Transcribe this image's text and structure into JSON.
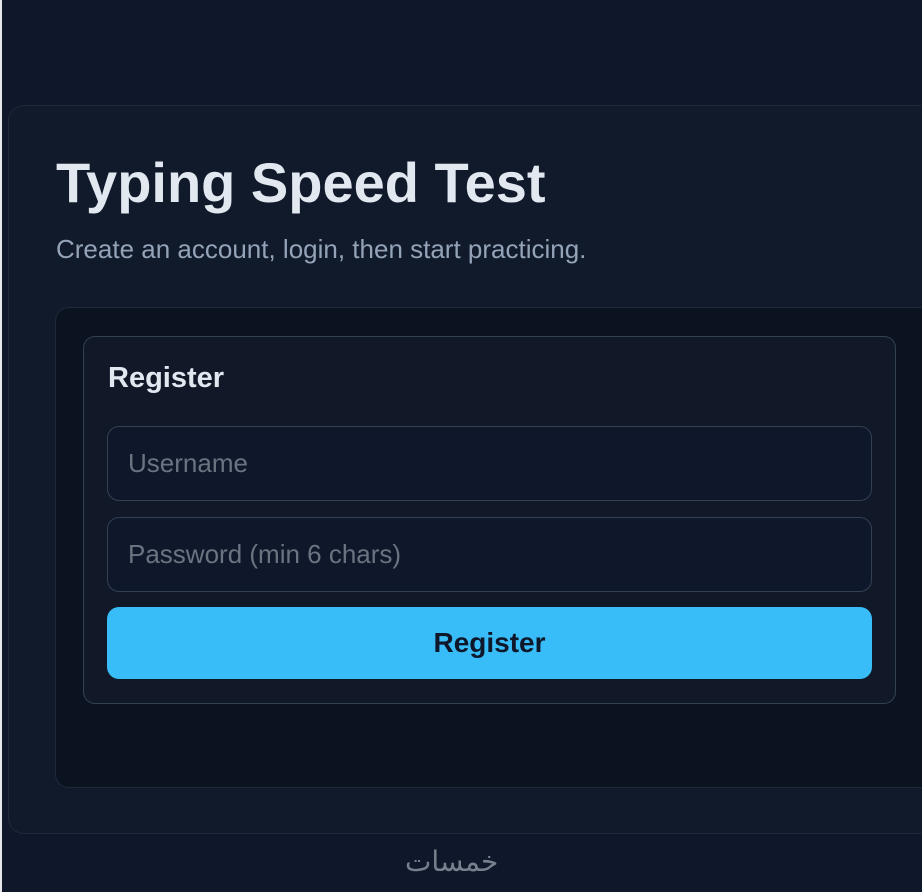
{
  "header": {
    "title": "Typing Speed Test",
    "subtitle": "Create an account, login, then start practicing."
  },
  "register": {
    "heading": "Register",
    "username_placeholder": "Username",
    "password_placeholder": "Password (min 6 chars)",
    "submit_label": "Register"
  },
  "colors": {
    "background": "#0f172a",
    "card": "#111a2b",
    "accent": "#38bdf8",
    "text": "#e2e8f0",
    "muted": "#94a3b8"
  },
  "watermark": {
    "text": "خمسات"
  }
}
